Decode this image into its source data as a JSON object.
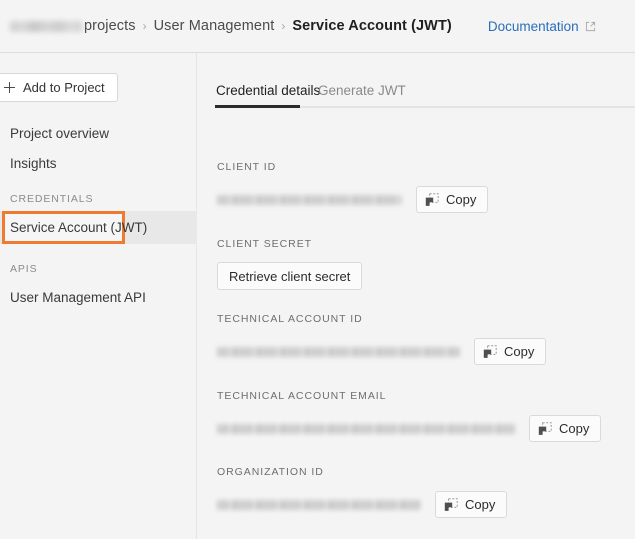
{
  "header": {
    "breadcrumb": [
      {
        "label": "Hidden Company",
        "redacted": true,
        "current": false
      },
      {
        "label": "projects",
        "redacted": false,
        "current": false
      },
      {
        "label": "User Management",
        "redacted": false,
        "current": false
      },
      {
        "label": "Service Account (JWT)",
        "redacted": false,
        "current": true
      }
    ],
    "separator": "›",
    "documentation_label": "Documentation",
    "documentation_icon": "external-link-icon"
  },
  "sidebar": {
    "add_button": {
      "label": "Add to Project",
      "icon": "plus-icon"
    },
    "items": [
      {
        "label": "Project overview",
        "type": "link"
      },
      {
        "label": "Insights",
        "type": "link"
      }
    ],
    "credentials_section": {
      "heading": "CREDENTIALS",
      "items": [
        {
          "label": "Service Account (JWT)",
          "selected": true,
          "highlighted": true
        }
      ]
    },
    "apis_section": {
      "heading": "APIS",
      "items": [
        {
          "label": "User Management API",
          "selected": false
        }
      ]
    },
    "highlight_color": "#ee7b2f",
    "selected_background": "#e8e8e8"
  },
  "main": {
    "tabs": [
      {
        "label": "Credential details",
        "active": true
      },
      {
        "label": "Generate JWT",
        "active": false
      }
    ],
    "active_tab_underline_color": "#2c2c2c",
    "fields": [
      {
        "label": "CLIENT ID",
        "value": "",
        "value_redacted": true,
        "value_width": 185,
        "action": {
          "type": "copy",
          "label": "Copy",
          "icon": "copy-icon"
        }
      },
      {
        "label": "CLIENT SECRET",
        "value": "",
        "value_redacted": false,
        "value_width": 0,
        "action": {
          "type": "button",
          "label": "Retrieve client secret",
          "icon": ""
        }
      },
      {
        "label": "TECHNICAL ACCOUNT ID",
        "value": "",
        "value_redacted": true,
        "value_width": 243,
        "action": {
          "type": "copy",
          "label": "Copy",
          "icon": "copy-icon"
        }
      },
      {
        "label": "TECHNICAL ACCOUNT EMAIL",
        "value": "",
        "value_redacted": true,
        "value_width": 298,
        "action": {
          "type": "copy",
          "label": "Copy",
          "icon": "copy-icon"
        }
      },
      {
        "label": "ORGANIZATION ID",
        "value": "",
        "value_redacted": true,
        "value_width": 204,
        "action": {
          "type": "copy",
          "label": "Copy",
          "icon": "copy-icon"
        }
      }
    ]
  }
}
